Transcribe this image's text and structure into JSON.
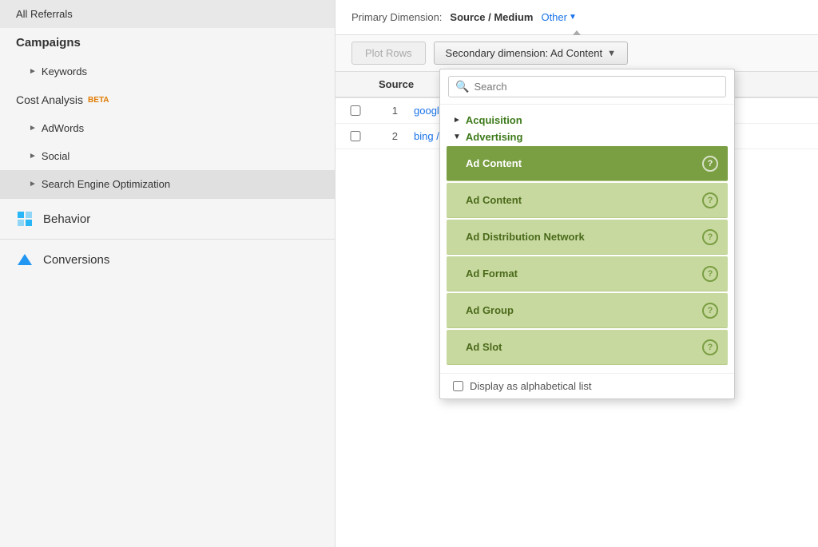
{
  "sidebar": {
    "items": [
      {
        "id": "all-referrals",
        "label": "All Referrals",
        "bold": false,
        "indent": false,
        "arrow": false
      },
      {
        "id": "campaigns",
        "label": "Campaigns",
        "bold": true,
        "indent": false,
        "arrow": false
      },
      {
        "id": "keywords",
        "label": "Keywords",
        "bold": false,
        "indent": true,
        "arrow": true
      },
      {
        "id": "cost-analysis",
        "label": "Cost Analysis",
        "bold": false,
        "indent": false,
        "arrow": false,
        "beta": true
      },
      {
        "id": "adwords",
        "label": "AdWords",
        "bold": false,
        "indent": true,
        "arrow": true
      },
      {
        "id": "social",
        "label": "Social",
        "bold": false,
        "indent": true,
        "arrow": true
      },
      {
        "id": "seo",
        "label": "Search Engine Optimization",
        "bold": false,
        "indent": true,
        "arrow": true,
        "active": true
      }
    ],
    "sections": [
      {
        "id": "behavior",
        "label": "Behavior",
        "icon": "behavior"
      },
      {
        "id": "conversions",
        "label": "Conversions",
        "icon": "conversions"
      }
    ]
  },
  "topbar": {
    "label": "Primary Dimension:",
    "dimension_value": "Source / Medium",
    "other_label": "Other"
  },
  "toolbar": {
    "plot_rows_label": "Plot Rows",
    "secondary_dim_label": "Secondary dimension: Ad Content"
  },
  "dropdown": {
    "search_placeholder": "Search",
    "categories": [
      {
        "id": "acquisition",
        "label": "Acquisition",
        "collapsed": true,
        "items": []
      },
      {
        "id": "advertising",
        "label": "Advertising",
        "collapsed": false,
        "items": [
          {
            "id": "ad-content-selected",
            "label": "Ad Content",
            "selected": true,
            "help": true
          },
          {
            "id": "ad-content-2",
            "label": "Ad Content",
            "selected": false,
            "help": true
          },
          {
            "id": "ad-distribution-network",
            "label": "Ad Distribution Network",
            "selected": false,
            "help": true
          },
          {
            "id": "ad-format",
            "label": "Ad Format",
            "selected": false,
            "help": true
          },
          {
            "id": "ad-group",
            "label": "Ad Group",
            "selected": false,
            "help": true
          },
          {
            "id": "ad-slot",
            "label": "Ad Slot",
            "selected": false,
            "help": true
          }
        ]
      }
    ],
    "footer_checkbox_label": "Display as alphabetical list"
  },
  "table": {
    "rows": [
      {
        "num": "1",
        "link": "googl"
      },
      {
        "num": "2",
        "link": "bing /"
      }
    ]
  },
  "colors": {
    "green_category": "#3d7a1a",
    "green_item_bg": "#c8d9a0",
    "green_selected": "#7a9e42",
    "blue_link": "#1a73e8",
    "beta_orange": "#e07b00"
  }
}
